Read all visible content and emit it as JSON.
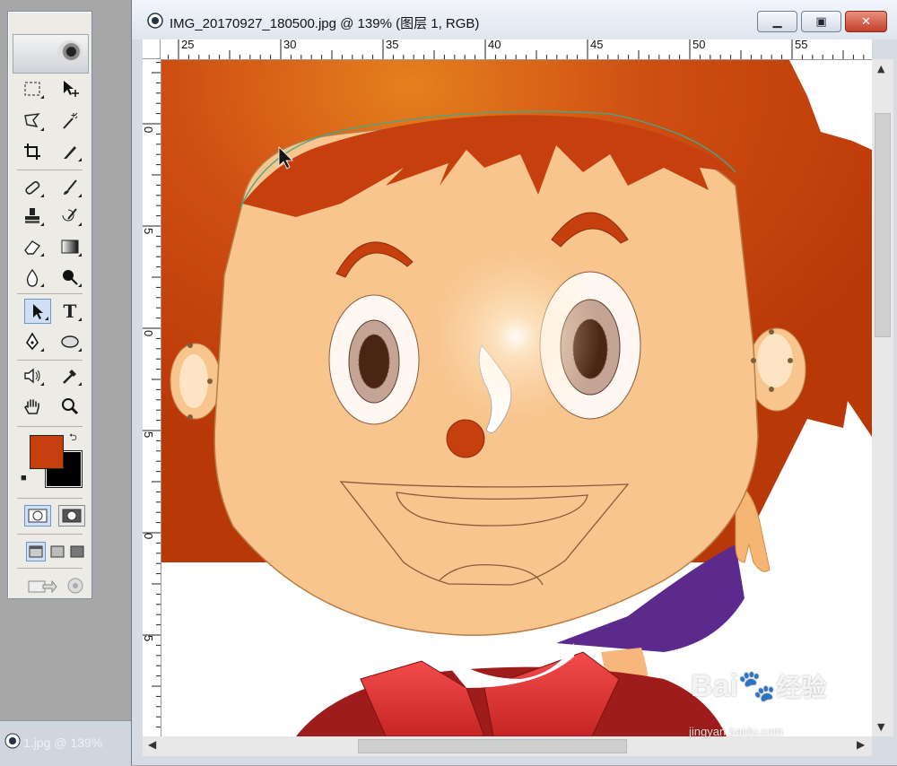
{
  "window": {
    "title": "IMG_20170927_180500.jpg @ 139% (图层 1, RGB)",
    "min_icon": "minimize-icon",
    "max_icon": "maximize-icon",
    "close_icon": "close-icon"
  },
  "rulers": {
    "horizontal": [
      "25",
      "30",
      "35",
      "40",
      "45",
      "50",
      "55"
    ],
    "vertical": [
      "0",
      "5",
      "0",
      "5",
      "0",
      "5"
    ]
  },
  "toolbox": {
    "tools": [
      {
        "icon": "marquee-icon"
      },
      {
        "icon": "move-icon"
      },
      {
        "icon": "lasso-icon"
      },
      {
        "icon": "magic-wand-icon"
      },
      {
        "icon": "crop-icon"
      },
      {
        "icon": "slice-icon"
      },
      {
        "icon": "healing-brush-icon"
      },
      {
        "icon": "brush-icon"
      },
      {
        "icon": "clone-stamp-icon"
      },
      {
        "icon": "history-brush-icon"
      },
      {
        "icon": "eraser-icon"
      },
      {
        "icon": "gradient-icon"
      },
      {
        "icon": "blur-icon"
      },
      {
        "icon": "dodge-icon"
      },
      {
        "icon": "path-selection-icon"
      },
      {
        "icon": "type-icon"
      },
      {
        "icon": "pen-icon"
      },
      {
        "icon": "ellipse-icon"
      },
      {
        "icon": "notes-icon"
      },
      {
        "icon": "eyedropper-icon"
      },
      {
        "icon": "hand-icon"
      },
      {
        "icon": "zoom-icon"
      }
    ],
    "type_tool_glyph": "T",
    "selected_tool": "path-selection-icon",
    "foreground_color": "#c5400e",
    "background_color": "#000000"
  },
  "minimized_doc": {
    "title": "1.jpg @ 139%"
  },
  "watermark": {
    "brand": "Bai",
    "brand_suffix": "经验",
    "url": "jingyan.baidu.com"
  },
  "colors": {
    "hair": "#c5400e",
    "skin": "#f8c58e",
    "collar": "#ec3a3a",
    "shirt": "#9e1c1c",
    "cape": "#5c2a8c"
  }
}
